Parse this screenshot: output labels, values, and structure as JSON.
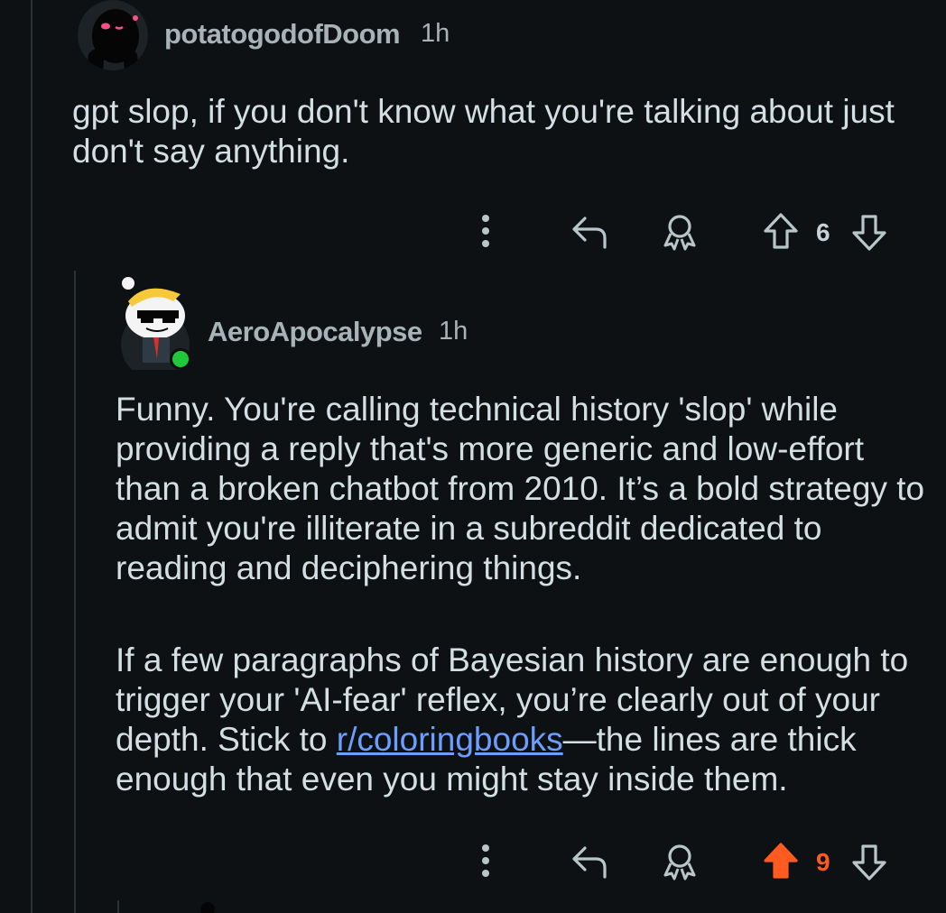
{
  "comments": [
    {
      "username": "potatogodofDoom",
      "time": "1h",
      "paragraphs": [
        "gpt slop, if you don't know what you're talking about just don't say anything."
      ],
      "votes": "6",
      "upvoted": false
    },
    {
      "username": "AeroApocalypse",
      "time": "1h",
      "paragraph1": "Funny. You're calling technical history 'slop' while providing a reply that's more generic and low-effort than a broken chatbot from 2010. It’s a bold strategy to admit you're illiterate in a subreddit dedicated to reading and deciphering things.",
      "paragraph2_before": "If a few paragraphs of Bayesian history are enough to trigger your 'AI-fear' reflex, you’re clearly out of your depth. Stick to ",
      "paragraph2_link": "r/coloringbooks",
      "paragraph2_after": "—the lines are thick enough that even you might stay inside them.",
      "votes": "9",
      "upvoted": true,
      "online": true
    }
  ],
  "icons": [
    "more-options-icon",
    "reply-icon",
    "award-icon",
    "upvote-icon",
    "downvote-icon"
  ],
  "colors": {
    "background": "#0e1113",
    "upvote_active": "#ff5a1f",
    "link": "#6b9eff",
    "online": "#1fc93a"
  }
}
